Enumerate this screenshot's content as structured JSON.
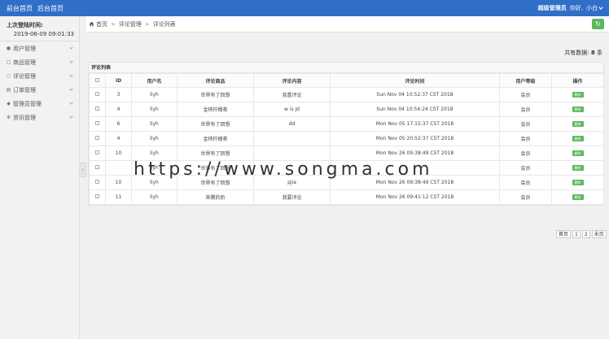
{
  "header": {
    "nav": [
      "前台首页",
      "后台首页"
    ],
    "user_role": "超级管理员",
    "greeting": "你好,",
    "user_name": "小白"
  },
  "sidebar": {
    "last_login_label": "上次登陆时间:",
    "last_login_time": "2019-06-09 09:01:33",
    "items": [
      {
        "label": "用户管理",
        "icon": "user-icon"
      },
      {
        "label": "商品管理",
        "icon": "box-icon"
      },
      {
        "label": "评论管理",
        "icon": "comment-icon"
      },
      {
        "label": "订单管理",
        "icon": "order-icon"
      },
      {
        "label": "管理员管理",
        "icon": "admin-icon"
      },
      {
        "label": "资讯管理",
        "icon": "news-icon"
      }
    ]
  },
  "breadcrumb": [
    "首页",
    "评论管理",
    "评论列表"
  ],
  "summary": {
    "total_label": "共有数据:",
    "total_value": "8",
    "total_unit": "条"
  },
  "panel": {
    "title": "评论列表",
    "columns": [
      "ID",
      "用户名",
      "评论商品",
      "评论内容",
      "评论时间",
      "用户等级",
      "操作"
    ],
    "rows": [
      {
        "id": "3",
        "user": "liyh",
        "product": "世界有了回想",
        "content": "我喜评论",
        "time": "Sun Nov 04 10:52:37 CST 2018",
        "level": "会员",
        "op": "删除"
      },
      {
        "id": "4",
        "user": "liyh",
        "product": "金柿柠檬茶",
        "content": "w is jd",
        "time": "Sun Nov 04 10:54:24 CST 2018",
        "level": "会员",
        "op": "删除"
      },
      {
        "id": "6",
        "user": "liyh",
        "product": "世界有了回想",
        "content": "dd",
        "time": "Mon Nov 05 17:15:37 CST 2018",
        "level": "会员",
        "op": "删除"
      },
      {
        "id": "4",
        "user": "liyh",
        "product": "金柿柠檬茶",
        "content": "",
        "time": "Mon Nov 05 20:52:37 CST 2018",
        "level": "会员",
        "op": "删除"
      },
      {
        "id": "10",
        "user": "liyh",
        "product": "世界有了回想",
        "content": "",
        "time": "Mon Nov 26 09:38:49 CST 2018",
        "level": "会员",
        "op": "删除"
      },
      {
        "id": "",
        "user": "liyh",
        "product": "世界有了回想",
        "content": "",
        "time": "",
        "level": "会员",
        "op": "删除"
      },
      {
        "id": "10",
        "user": "liyh",
        "product": "世界有了回想",
        "content": "pjia",
        "time": "Mon Nov 26 09:38:49 CST 2018",
        "level": "会员",
        "op": "删除"
      },
      {
        "id": "11",
        "user": "liyh",
        "product": "奔腾的奶",
        "content": "我要评论",
        "time": "Mon Nov 26 09:41:12 CST 2018",
        "level": "会员",
        "op": "删除"
      }
    ]
  },
  "pagination": [
    "首页",
    "1",
    "2",
    "末页"
  ],
  "watermark": "https://www.songma.com",
  "colors": {
    "topbar": "#2f6fc7",
    "accent_green": "#5cb85c"
  }
}
